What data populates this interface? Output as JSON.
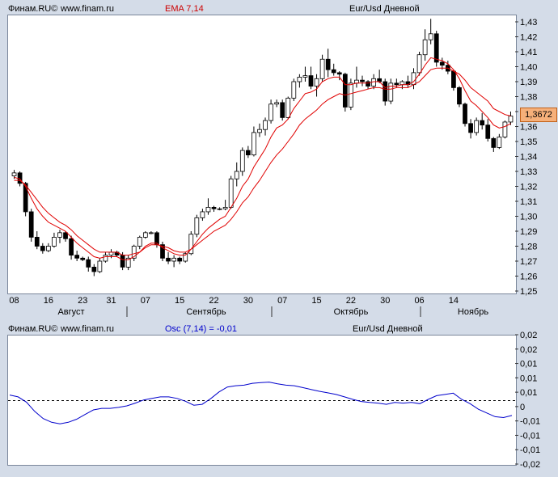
{
  "top_header": {
    "brand": "Финам.RU©",
    "site": "www.finam.ru",
    "indicator": "EMA 7,14",
    "instrument": "Eur/Usd Дневной"
  },
  "bottom_header": {
    "brand": "Финам.RU©",
    "site": "www.finam.ru",
    "indicator": "Osc (7,14) = -0,01",
    "instrument": "Eur/Usd Дневной"
  },
  "last_price_label": "1,3672",
  "colors": {
    "up_candle": "#ffffff",
    "down_candle": "#000000",
    "ema": "#e00000",
    "osc": "#0000cc",
    "price_tag": "#f6b07a"
  },
  "chart_data": [
    {
      "type": "candlestick",
      "y_ticks": [
        "1,43",
        "1,42",
        "1,41",
        "1,40",
        "1,39",
        "1,38",
        "1,37",
        "1,36",
        "1,35",
        "1,34",
        "1,33",
        "1,32",
        "1,31",
        "1,30",
        "1,29",
        "1,28",
        "1,27",
        "1,26",
        "1,25"
      ],
      "ylim": [
        1.25,
        1.43
      ],
      "x_ticks": [
        "08",
        "16",
        "23",
        "31",
        "07",
        "15",
        "22",
        "30",
        "07",
        "15",
        "22",
        "30",
        "06",
        "14"
      ],
      "months": [
        "Август",
        "Сентябрь",
        "Октябрь",
        "Ноябрь"
      ],
      "candles": [
        [
          1.327,
          1.331,
          1.325,
          1.329
        ],
        [
          1.329,
          1.33,
          1.32,
          1.322
        ],
        [
          1.322,
          1.323,
          1.3,
          1.303
        ],
        [
          1.303,
          1.305,
          1.283,
          1.286
        ],
        [
          1.286,
          1.29,
          1.278,
          1.28
        ],
        [
          1.28,
          1.282,
          1.275,
          1.277
        ],
        [
          1.277,
          1.282,
          1.276,
          1.28
        ],
        [
          1.28,
          1.289,
          1.279,
          1.286
        ],
        [
          1.286,
          1.291,
          1.282,
          1.289
        ],
        [
          1.289,
          1.29,
          1.283,
          1.285
        ],
        [
          1.285,
          1.287,
          1.271,
          1.274
        ],
        [
          1.274,
          1.277,
          1.27,
          1.272
        ],
        [
          1.272,
          1.273,
          1.27,
          1.271
        ],
        [
          1.271,
          1.273,
          1.263,
          1.266
        ],
        [
          1.266,
          1.268,
          1.26,
          1.263
        ],
        [
          1.263,
          1.272,
          1.262,
          1.27
        ],
        [
          1.27,
          1.276,
          1.269,
          1.274
        ],
        [
          1.274,
          1.278,
          1.272,
          1.276
        ],
        [
          1.276,
          1.277,
          1.273,
          1.274
        ],
        [
          1.274,
          1.276,
          1.264,
          1.266
        ],
        [
          1.266,
          1.274,
          1.264,
          1.272
        ],
        [
          1.272,
          1.281,
          1.27,
          1.28
        ],
        [
          1.28,
          1.287,
          1.278,
          1.286
        ],
        [
          1.286,
          1.29,
          1.285,
          1.289
        ],
        [
          1.289,
          1.29,
          1.288,
          1.289
        ],
        [
          1.289,
          1.29,
          1.279,
          1.281
        ],
        [
          1.281,
          1.283,
          1.27,
          1.272
        ],
        [
          1.272,
          1.276,
          1.268,
          1.27
        ],
        [
          1.27,
          1.274,
          1.266,
          1.272
        ],
        [
          1.272,
          1.273,
          1.268,
          1.27
        ],
        [
          1.27,
          1.276,
          1.269,
          1.275
        ],
        [
          1.275,
          1.29,
          1.274,
          1.288
        ],
        [
          1.288,
          1.301,
          1.286,
          1.299
        ],
        [
          1.299,
          1.305,
          1.297,
          1.303
        ],
        [
          1.303,
          1.312,
          1.301,
          1.306
        ],
        [
          1.306,
          1.307,
          1.303,
          1.305
        ],
        [
          1.305,
          1.306,
          1.304,
          1.305
        ],
        [
          1.305,
          1.311,
          1.304,
          1.306
        ],
        [
          1.306,
          1.327,
          1.305,
          1.325
        ],
        [
          1.325,
          1.336,
          1.32,
          1.33
        ],
        [
          1.33,
          1.346,
          1.327,
          1.344
        ],
        [
          1.344,
          1.347,
          1.339,
          1.341
        ],
        [
          1.341,
          1.36,
          1.34,
          1.356
        ],
        [
          1.356,
          1.362,
          1.353,
          1.358
        ],
        [
          1.358,
          1.366,
          1.354,
          1.364
        ],
        [
          1.364,
          1.378,
          1.362,
          1.375
        ],
        [
          1.375,
          1.378,
          1.373,
          1.376
        ],
        [
          1.376,
          1.378,
          1.364,
          1.366
        ],
        [
          1.366,
          1.38,
          1.365,
          1.379
        ],
        [
          1.379,
          1.392,
          1.377,
          1.39
        ],
        [
          1.39,
          1.395,
          1.386,
          1.393
        ],
        [
          1.393,
          1.4,
          1.39,
          1.394
        ],
        [
          1.394,
          1.4,
          1.385,
          1.387
        ],
        [
          1.387,
          1.395,
          1.38,
          1.392
        ],
        [
          1.392,
          1.408,
          1.39,
          1.405
        ],
        [
          1.405,
          1.412,
          1.393,
          1.398
        ],
        [
          1.398,
          1.402,
          1.394,
          1.396
        ],
        [
          1.396,
          1.397,
          1.391,
          1.395
        ],
        [
          1.395,
          1.396,
          1.37,
          1.373
        ],
        [
          1.373,
          1.392,
          1.371,
          1.389
        ],
        [
          1.389,
          1.4,
          1.386,
          1.391
        ],
        [
          1.391,
          1.394,
          1.387,
          1.39
        ],
        [
          1.39,
          1.391,
          1.385,
          1.387
        ],
        [
          1.387,
          1.395,
          1.385,
          1.392
        ],
        [
          1.392,
          1.398,
          1.389,
          1.39
        ],
        [
          1.39,
          1.392,
          1.374,
          1.377
        ],
        [
          1.377,
          1.392,
          1.375,
          1.389
        ],
        [
          1.389,
          1.392,
          1.386,
          1.388
        ],
        [
          1.388,
          1.391,
          1.385,
          1.39
        ],
        [
          1.39,
          1.394,
          1.386,
          1.388
        ],
        [
          1.388,
          1.399,
          1.385,
          1.396
        ],
        [
          1.396,
          1.41,
          1.394,
          1.408
        ],
        [
          1.408,
          1.425,
          1.404,
          1.418
        ],
        [
          1.418,
          1.432,
          1.415,
          1.422
        ],
        [
          1.422,
          1.424,
          1.4,
          1.403
        ],
        [
          1.403,
          1.406,
          1.398,
          1.401
        ],
        [
          1.401,
          1.404,
          1.395,
          1.397
        ],
        [
          1.397,
          1.398,
          1.384,
          1.386
        ],
        [
          1.386,
          1.387,
          1.373,
          1.375
        ],
        [
          1.375,
          1.376,
          1.36,
          1.362
        ],
        [
          1.362,
          1.365,
          1.352,
          1.356
        ],
        [
          1.356,
          1.366,
          1.354,
          1.364
        ],
        [
          1.364,
          1.369,
          1.358,
          1.361
        ],
        [
          1.361,
          1.365,
          1.35,
          1.352
        ],
        [
          1.352,
          1.353,
          1.343,
          1.346
        ],
        [
          1.346,
          1.355,
          1.345,
          1.353
        ],
        [
          1.353,
          1.364,
          1.352,
          1.363
        ],
        [
          1.363,
          1.37,
          1.361,
          1.367
        ]
      ],
      "ema_fast": [
        1.326,
        1.325,
        1.32,
        1.312,
        1.305,
        1.3,
        1.296,
        1.294,
        1.292,
        1.29,
        1.286,
        1.282,
        1.279,
        1.276,
        1.273,
        1.272,
        1.273,
        1.273,
        1.273,
        1.271,
        1.271,
        1.273,
        1.276,
        1.28,
        1.282,
        1.282,
        1.279,
        1.277,
        1.275,
        1.274,
        1.274,
        1.278,
        1.283,
        1.288,
        1.292,
        1.295,
        1.298,
        1.3,
        1.306,
        1.312,
        1.32,
        1.325,
        1.333,
        1.339,
        1.345,
        1.353,
        1.359,
        1.361,
        1.365,
        1.372,
        1.377,
        1.382,
        1.383,
        1.385,
        1.39,
        1.392,
        1.393,
        1.393,
        1.388,
        1.388,
        1.389,
        1.389,
        1.389,
        1.39,
        1.39,
        1.386,
        1.387,
        1.387,
        1.388,
        1.388,
        1.39,
        1.395,
        1.401,
        1.406,
        1.405,
        1.404,
        1.402,
        1.398,
        1.392,
        1.384,
        1.377,
        1.374,
        1.37,
        1.366,
        1.361,
        1.359,
        1.36,
        1.362
      ],
      "ema_slow": [
        1.324,
        1.324,
        1.321,
        1.316,
        1.311,
        1.306,
        1.302,
        1.299,
        1.296,
        1.294,
        1.291,
        1.287,
        1.284,
        1.281,
        1.278,
        1.276,
        1.276,
        1.276,
        1.276,
        1.274,
        1.274,
        1.275,
        1.276,
        1.279,
        1.281,
        1.281,
        1.28,
        1.279,
        1.277,
        1.276,
        1.276,
        1.278,
        1.281,
        1.284,
        1.287,
        1.29,
        1.292,
        1.294,
        1.298,
        1.303,
        1.309,
        1.313,
        1.319,
        1.324,
        1.33,
        1.336,
        1.341,
        1.345,
        1.35,
        1.355,
        1.361,
        1.365,
        1.368,
        1.371,
        1.375,
        1.378,
        1.38,
        1.382,
        1.381,
        1.382,
        1.383,
        1.384,
        1.385,
        1.386,
        1.386,
        1.385,
        1.385,
        1.386,
        1.386,
        1.386,
        1.388,
        1.39,
        1.394,
        1.398,
        1.399,
        1.399,
        1.399,
        1.397,
        1.395,
        1.391,
        1.386,
        1.383,
        1.38,
        1.377,
        1.372,
        1.37,
        1.368,
        1.367
      ]
    },
    {
      "type": "line",
      "y_ticks": [
        "0,02",
        "0,02",
        "0,01",
        "0,01",
        "0,01",
        "0",
        "-0,01",
        "-0,01",
        "-0,01",
        "-0,02"
      ],
      "ylim": [
        -0.02,
        0.02
      ],
      "osc": [
        0.0018,
        0.0012,
        -0.0005,
        -0.0035,
        -0.0058,
        -0.007,
        -0.0075,
        -0.007,
        -0.006,
        -0.0045,
        -0.003,
        -0.0025,
        -0.0025,
        -0.0022,
        -0.0017,
        -0.0008,
        0.0002,
        0.0007,
        0.0012,
        0.0012,
        0.0007,
        -0.0002,
        -0.0015,
        -0.0012,
        0.0006,
        0.0028,
        0.0044,
        0.0048,
        0.005,
        0.0056,
        0.0058,
        0.006,
        0.0054,
        0.005,
        0.0048,
        0.0042,
        0.0036,
        0.003,
        0.0025,
        0.002,
        0.0012,
        0.0004,
        -0.0003,
        -0.0006,
        -0.0008,
        -0.0012,
        -0.0006,
        -0.0008,
        -0.0006,
        -0.001,
        0.0004,
        0.0016,
        0.002,
        0.0024,
        0.0004,
        -0.001,
        -0.0028,
        -0.004,
        -0.0052,
        -0.0055,
        -0.0048
      ]
    }
  ]
}
